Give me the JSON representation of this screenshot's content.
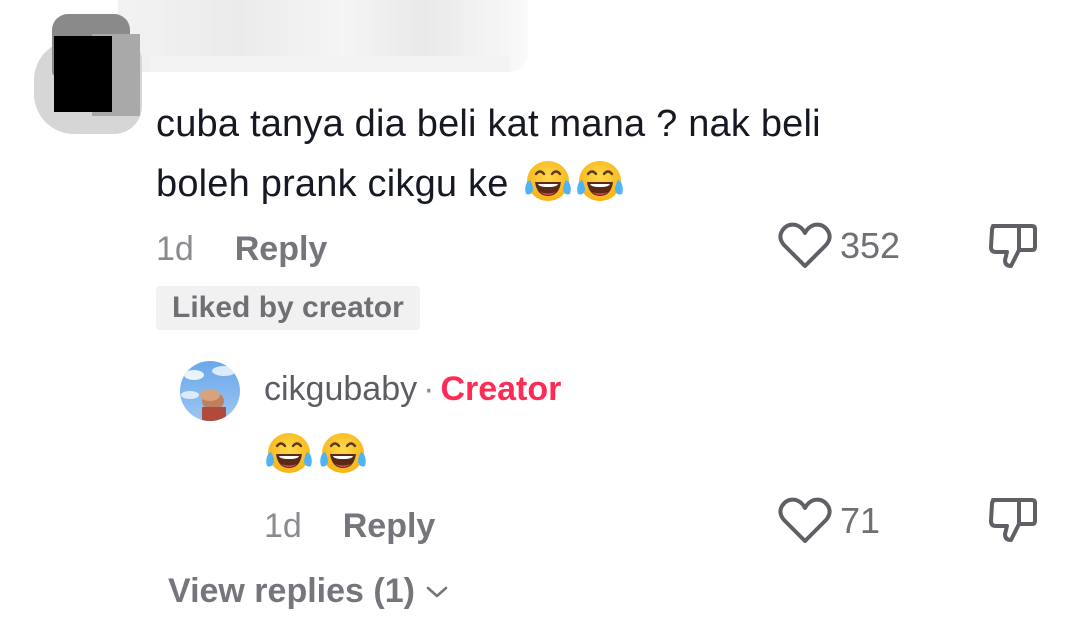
{
  "comment": {
    "text_line1": "cuba tanya dia beli kat mana ? nak beli",
    "text_line2": "boleh prank cikgu ke",
    "emojis": [
      "face-with-tears-of-joy",
      "face-with-tears-of-joy"
    ],
    "age": "1d",
    "reply_label": "Reply",
    "like_count": "352",
    "liked_badge": "Liked by creator"
  },
  "reply": {
    "username": "cikgubaby",
    "separator": "·",
    "creator_label": "Creator",
    "emojis": [
      "face-with-tears-of-joy",
      "face-with-tears-of-joy"
    ],
    "age": "1d",
    "reply_label": "Reply",
    "like_count": "71"
  },
  "view_replies_label": "View replies (1)",
  "icons": {
    "like": "heart-outline-icon",
    "dislike": "thumbs-down-icon",
    "expand": "chevron-down-icon"
  },
  "colors": {
    "creator_accent": "#fe2c55",
    "text_primary": "#161823",
    "text_secondary": "#75767b",
    "badge_bg": "#f1f1f2"
  }
}
